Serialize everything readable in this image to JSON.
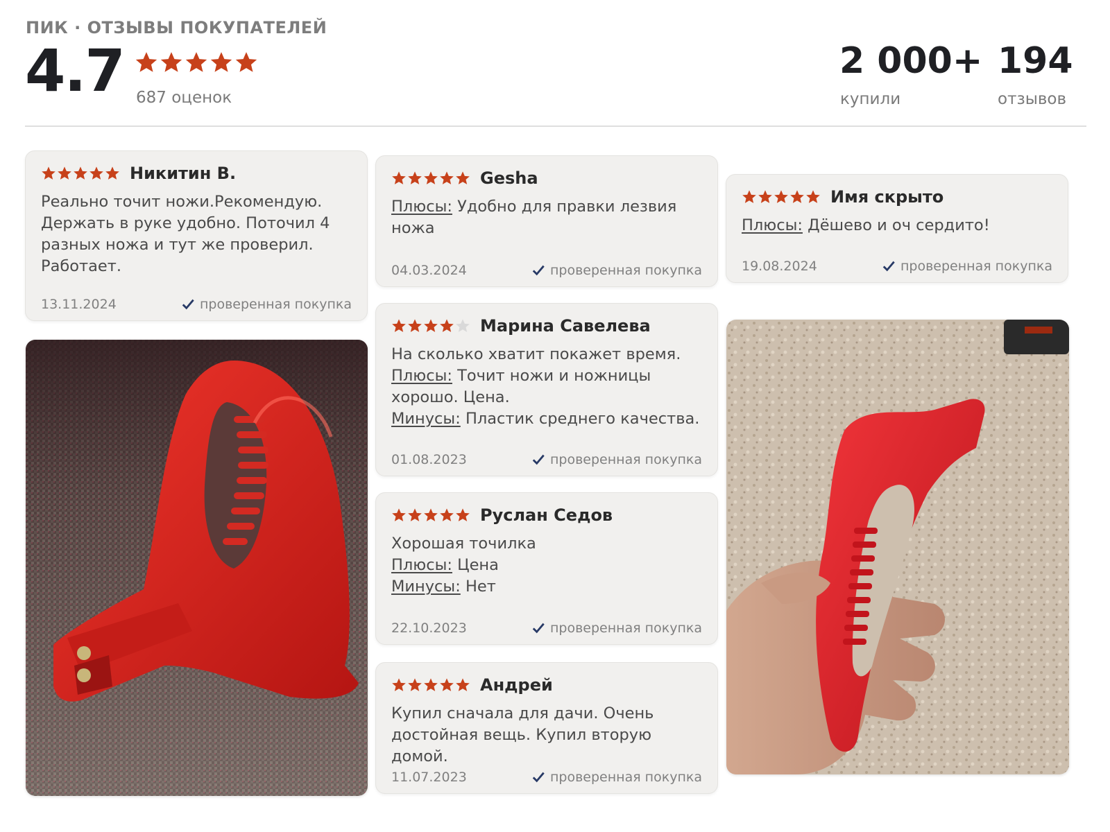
{
  "header": {
    "brand_line": "ПИК · ОТЗЫВЫ ПОКУПАТЕЛЕЙ",
    "rating": "4.7",
    "stars": 5,
    "ratings_count": "687 оценок",
    "bought_value": "2 000+",
    "bought_label": "купили",
    "reviews_value": "194",
    "reviews_label": "отзывов"
  },
  "labels": {
    "pros": "Плюсы:",
    "cons": "Минусы:",
    "verified": "проверенная покупка"
  },
  "colors": {
    "star": "#c7411a",
    "star_empty": "#d9d9d9",
    "check": "#283a66",
    "card_bg": "#f1f0ee"
  },
  "reviews": [
    {
      "author": "Никитин В.",
      "stars": 5,
      "text": "Реально точит ножи.Рекомендую. Держать в руке удобно. Поточил 4 разных ножа и тут же проверил. Работает.",
      "pros": "",
      "cons": "",
      "date": "13.11.2024"
    },
    {
      "author": "Gesha",
      "stars": 5,
      "text": "",
      "pros": "Удобно для правки лезвия ножа",
      "cons": "",
      "date": "04.03.2024"
    },
    {
      "author": "Марина Савелева",
      "stars": 4,
      "text": "На сколько хватит покажет время.",
      "pros": "Точит ножи и ножницы хорошо. Цена.",
      "cons": "Пластик среднего качества.",
      "date": "01.08.2023"
    },
    {
      "author": "Руслан Седов",
      "stars": 5,
      "text": "Хорошая точилка",
      "pros": "Цена",
      "cons": "Нет",
      "date": "22.10.2023"
    },
    {
      "author": "Андрей",
      "stars": 5,
      "text": "Купил сначала для дачи. Очень достойная вещь. Купил вторую домой.",
      "pros": "",
      "cons": "",
      "date": "11.07.2023"
    },
    {
      "author": "Имя скрыто",
      "stars": 5,
      "text": "",
      "pros": "Дёшево и оч сердито!",
      "cons": "",
      "date": "19.08.2024"
    }
  ],
  "photos": [
    {
      "subject": "red plastic knife sharpener on woven mat"
    },
    {
      "subject": "hand holding red plastic knife sharpener"
    }
  ]
}
